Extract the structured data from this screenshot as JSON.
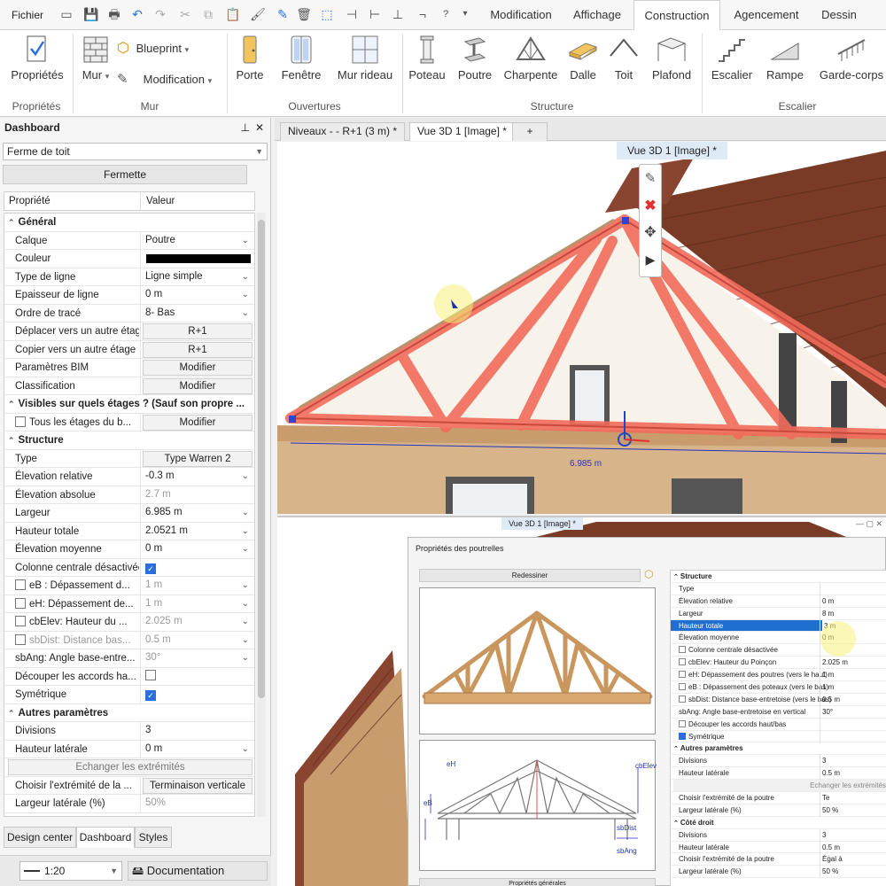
{
  "menubar": {
    "fichier": "Fichier",
    "tabs": [
      "Modification",
      "Affichage",
      "Construction",
      "Agencement",
      "Dessin"
    ],
    "active_tab": "Construction"
  },
  "ribbon": {
    "groups": {
      "proprietes": "Propriétés",
      "mur": "Mur",
      "ouvertures": "Ouvertures",
      "structure": "Structure",
      "escalier": "Escalier"
    },
    "buttons": {
      "proprietes": "Propriétés",
      "mur": "Mur",
      "blueprint": "Blueprint",
      "modification": "Modification",
      "porte": "Porte",
      "fenetre": "Fenêtre",
      "mur_rideau": "Mur rideau",
      "poteau": "Poteau",
      "poutre": "Poutre",
      "charpente": "Charpente",
      "dalle": "Dalle",
      "toit": "Toit",
      "plafond": "Plafond",
      "escalier": "Escalier",
      "rampe": "Rampe",
      "garde_corps": "Garde-corps"
    }
  },
  "dashboard": {
    "title": "Dashboard",
    "pin": "⊥",
    "close": "✕",
    "object_type": "Ferme de toit",
    "fermette_button": "Fermette",
    "header_key": "Propriété",
    "header_value": "Valeur",
    "rows": [
      {
        "t": "sec",
        "k": "Général"
      },
      {
        "t": "sel",
        "k": "Calque",
        "v": "Poutre"
      },
      {
        "t": "color",
        "k": "Couleur",
        "v": "#000000"
      },
      {
        "t": "sel",
        "k": "Type de ligne",
        "v": "Ligne simple"
      },
      {
        "t": "sel",
        "k": "Epaisseur de ligne",
        "v": "0 m"
      },
      {
        "t": "sel",
        "k": "Ordre de tracé",
        "v": "8- Bas"
      },
      {
        "t": "btn",
        "k": "Déplacer vers un autre étage",
        "v": "R+1"
      },
      {
        "t": "btn",
        "k": "Copier vers un autre étage",
        "v": "R+1"
      },
      {
        "t": "btn",
        "k": "Paramètres BIM",
        "v": "Modifier"
      },
      {
        "t": "btn",
        "k": "Classification",
        "v": "Modifier"
      },
      {
        "t": "sec",
        "k": "Visibles sur quels étages ? (Sauf son propre ..."
      },
      {
        "t": "cbbtn",
        "k": "Tous les étages du b...",
        "v": "Modifier"
      },
      {
        "t": "sec",
        "k": "Structure"
      },
      {
        "t": "btn",
        "k": "Type",
        "v": "Type Warren 2"
      },
      {
        "t": "sel",
        "k": "Élevation relative",
        "v": "-0.3 m"
      },
      {
        "t": "plain",
        "k": "Élevation absolue",
        "v": "2.7 m",
        "g": true
      },
      {
        "t": "sel",
        "k": "Largeur",
        "v": "6.985 m"
      },
      {
        "t": "sel",
        "k": "Hauteur totale",
        "v": "2.0521 m"
      },
      {
        "t": "sel",
        "k": "Élevation moyenne",
        "v": "0 m"
      },
      {
        "t": "cbv",
        "k": "Colonne centrale désactivée",
        "on": true
      },
      {
        "t": "cbsel",
        "k": "eB : Dépassement d...",
        "v": "1 m",
        "g": true
      },
      {
        "t": "cbsel",
        "k": "eH: Dépassement de...",
        "v": "1 m",
        "g": true
      },
      {
        "t": "cbsel",
        "k": "cbElev: Hauteur du ...",
        "v": "2.025 m",
        "g": true
      },
      {
        "t": "cbsel",
        "k": "sbDist: Distance bas...",
        "v": "0.5 m",
        "g": true,
        "gk": true
      },
      {
        "t": "sel",
        "k": "sbAng: Angle  base-entre...",
        "v": "30°",
        "g": true
      },
      {
        "t": "cbv",
        "k": "Découper les accords ha...",
        "on": false
      },
      {
        "t": "cbv",
        "k": "Symétrique",
        "on": true
      },
      {
        "t": "sec",
        "k": "Autres paramètres"
      },
      {
        "t": "plain",
        "k": "Divisions",
        "v": "3"
      },
      {
        "t": "sel",
        "k": "Hauteur latérale",
        "v": "0 m"
      },
      {
        "t": "full",
        "v": "Echanger les extrémités"
      },
      {
        "t": "btn",
        "k": "Choisir l'extrémité de la ...",
        "v": "Terminaison verticale"
      },
      {
        "t": "plain",
        "k": "Largeur latérale (%)",
        "v": "50%",
        "g": true
      },
      {
        "t": "sec",
        "k": "Côté droit"
      }
    ],
    "bottom_tabs": [
      "Design center",
      "Dashboard",
      "Styles"
    ],
    "status_scale": "1:20",
    "status_doc": "Documentation"
  },
  "viewport": {
    "doc_tabs": [
      "Niveaux -  - R+1 (3 m) *",
      "Vue 3D 1 [Image] *",
      "+"
    ],
    "view_title": "Vue 3D 1 [Image] *",
    "dimension": "6.985 m",
    "view2_title": "Vue 3D 1 [Image] *"
  },
  "dialog": {
    "title": "Propriétés des poutrelles",
    "redraw": "Redessiner",
    "general_props": "Propriétés générales",
    "labels": {
      "eH": "eH",
      "eB": "eB",
      "cbElev": "cbElev",
      "sbDist": "sbDist",
      "sbAng": "sbAng"
    },
    "rows": [
      {
        "t": "sec",
        "k": "Structure"
      },
      {
        "k": "Type",
        "v": ""
      },
      {
        "k": "Élevation relative",
        "v": "0 m"
      },
      {
        "k": "Largeur",
        "v": "8 m"
      },
      {
        "k": "Hauteur totale",
        "v": "3 m",
        "hl": true
      },
      {
        "k": "Élevation moyenne",
        "v": "0 m"
      },
      {
        "k": "Colonne centrale désactivée",
        "cb": false
      },
      {
        "k": "cbElev: Hauteur du Poinçon",
        "v": "2.025 m",
        "cb": false
      },
      {
        "k": "eH: Dépassement des poutres (vers le haut)",
        "v": "1 m",
        "cb": false
      },
      {
        "k": "eB : Dépassement des poteaux (vers le bas)",
        "v": "1 m",
        "cb": false
      },
      {
        "k": "sbDist: Distance base-entretoise (vers le bas)",
        "v": "0.5 m",
        "cb": false
      },
      {
        "k": "sbAng: Angle  base-entretoise en vertical",
        "v": "30°"
      },
      {
        "k": "Découper les accords haut/bas",
        "cb": false
      },
      {
        "k": "Symétrique",
        "cb": true
      },
      {
        "t": "sec",
        "k": "Autres paramètres"
      },
      {
        "k": "Divisions",
        "v": "3"
      },
      {
        "k": "Hauteur latérale",
        "v": "0.5 m"
      },
      {
        "t": "full",
        "v": "Echanger les extrémités"
      },
      {
        "k": "Choisir l'extrémité de la poutre",
        "v": "Te"
      },
      {
        "k": "Largeur latérale (%)",
        "v": "50 %"
      },
      {
        "t": "sec",
        "k": "Côté droit"
      },
      {
        "k": "Divisions",
        "v": "3"
      },
      {
        "k": "Hauteur latérale",
        "v": "0.5 m"
      },
      {
        "k": "Choisir l'extrémité de la poutre",
        "v": "Égal à"
      },
      {
        "k": "Largeur latérale (%)",
        "v": "50 %"
      }
    ]
  },
  "colors": {
    "accent": "#1f6fd1",
    "truss_highlight": "#f26b5b",
    "roof_tile": "#7a3b26",
    "wall": "#d8b48a"
  }
}
